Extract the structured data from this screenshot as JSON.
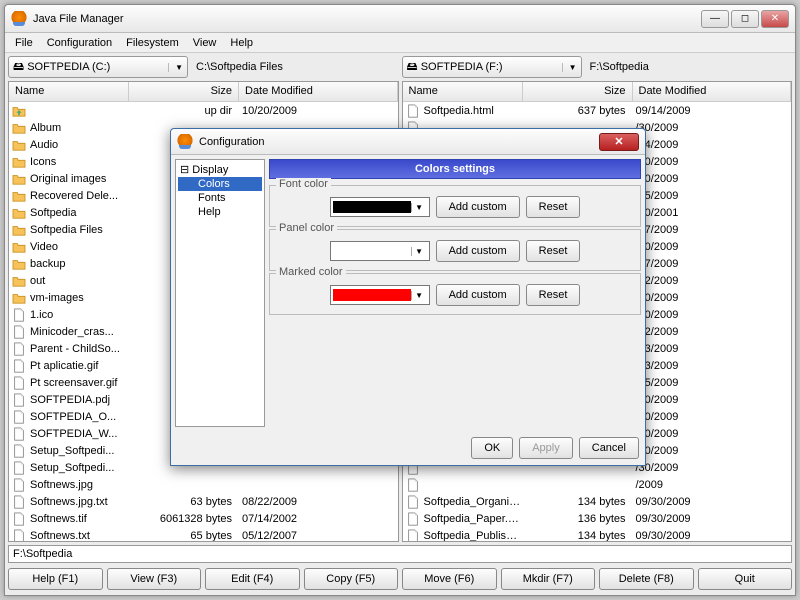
{
  "window": {
    "title": "Java File Manager"
  },
  "menu": [
    "File",
    "Configuration",
    "Filesystem",
    "View",
    "Help"
  ],
  "left": {
    "drive": "SOFTPEDIA (C:)",
    "path": "C:\\Softpedia Files",
    "cols": [
      "Name",
      "Size",
      "Date Modified"
    ],
    "rows": [
      {
        "t": "up",
        "n": "",
        "s": "up dir",
        "d": "10/20/2009"
      },
      {
        "t": "fld",
        "n": "Album",
        "s": "",
        "d": ""
      },
      {
        "t": "fld",
        "n": "Audio",
        "s": "",
        "d": ""
      },
      {
        "t": "fld",
        "n": "Icons",
        "s": "",
        "d": ""
      },
      {
        "t": "fld",
        "n": "Original images",
        "s": "",
        "d": ""
      },
      {
        "t": "fld",
        "n": "Recovered Dele...",
        "s": "",
        "d": ""
      },
      {
        "t": "fld",
        "n": "Softpedia",
        "s": "",
        "d": ""
      },
      {
        "t": "fld",
        "n": "Softpedia Files",
        "s": "",
        "d": ""
      },
      {
        "t": "fld",
        "n": "Video",
        "s": "",
        "d": ""
      },
      {
        "t": "fld",
        "n": "backup",
        "s": "",
        "d": ""
      },
      {
        "t": "fld",
        "n": "out",
        "s": "",
        "d": ""
      },
      {
        "t": "fld",
        "n": "vm-images",
        "s": "",
        "d": ""
      },
      {
        "t": "f",
        "n": "1.ico",
        "s": "",
        "d": ""
      },
      {
        "t": "f",
        "n": "Minicoder_cras...",
        "s": "",
        "d": ""
      },
      {
        "t": "f",
        "n": "Parent - ChildSo...",
        "s": "",
        "d": ""
      },
      {
        "t": "f",
        "n": "Pt aplicatie.gif",
        "s": "",
        "d": ""
      },
      {
        "t": "f",
        "n": "Pt screensaver.gif",
        "s": "",
        "d": ""
      },
      {
        "t": "f",
        "n": "SOFTPEDIA.pdj",
        "s": "",
        "d": ""
      },
      {
        "t": "f",
        "n": "SOFTPEDIA_O...",
        "s": "",
        "d": ""
      },
      {
        "t": "f",
        "n": "SOFTPEDIA_W...",
        "s": "",
        "d": ""
      },
      {
        "t": "f",
        "n": "Setup_Softpedi...",
        "s": "",
        "d": ""
      },
      {
        "t": "f",
        "n": "Setup_Softpedi...",
        "s": "",
        "d": ""
      },
      {
        "t": "f",
        "n": "Softnews.jpg",
        "s": "",
        "d": ""
      },
      {
        "t": "f",
        "n": "Softnews.jpg.txt",
        "s": "63 bytes",
        "d": "08/22/2009"
      },
      {
        "t": "f",
        "n": "Softnews.tif",
        "s": "6061328 bytes",
        "d": "07/14/2002"
      },
      {
        "t": "f",
        "n": "Softnews.txt",
        "s": "65 bytes",
        "d": "05/12/2007"
      }
    ]
  },
  "right": {
    "drive": "SOFTPEDIA (F:)",
    "path": "F:\\Softpedia",
    "cols": [
      "Name",
      "Size",
      "Date Modified"
    ],
    "rows": [
      {
        "t": "f",
        "n": "Softpedia.html",
        "s": "637 bytes",
        "d": "09/14/2009"
      },
      {
        "t": "f",
        "n": "",
        "s": "",
        "d": "/30/2009"
      },
      {
        "t": "f",
        "n": "",
        "s": "",
        "d": "/04/2009"
      },
      {
        "t": "f",
        "n": "",
        "s": "",
        "d": "/30/2009"
      },
      {
        "t": "f",
        "n": "",
        "s": "",
        "d": "/30/2009"
      },
      {
        "t": "f",
        "n": "",
        "s": "",
        "d": "/05/2009"
      },
      {
        "t": "f",
        "n": "",
        "s": "",
        "d": "/30/2001"
      },
      {
        "t": "f",
        "n": "",
        "s": "",
        "d": "/17/2009"
      },
      {
        "t": "f",
        "n": "",
        "s": "",
        "d": "/30/2009"
      },
      {
        "t": "f",
        "n": "",
        "s": "",
        "d": "/17/2009"
      },
      {
        "t": "f",
        "n": "",
        "s": "",
        "d": "/12/2009"
      },
      {
        "t": "f",
        "n": "",
        "s": "",
        "d": "/30/2009"
      },
      {
        "t": "f",
        "n": "",
        "s": "",
        "d": "/30/2009"
      },
      {
        "t": "f",
        "n": "",
        "s": "",
        "d": "/12/2009"
      },
      {
        "t": "f",
        "n": "",
        "s": "",
        "d": "/13/2009"
      },
      {
        "t": "f",
        "n": "",
        "s": "",
        "d": "/13/2009"
      },
      {
        "t": "f",
        "n": "",
        "s": "",
        "d": "/15/2009"
      },
      {
        "t": "f",
        "n": "",
        "s": "",
        "d": "/30/2009"
      },
      {
        "t": "f",
        "n": "",
        "s": "",
        "d": "/30/2009"
      },
      {
        "t": "f",
        "n": "",
        "s": "",
        "d": "/30/2009"
      },
      {
        "t": "f",
        "n": "",
        "s": "",
        "d": "/30/2009"
      },
      {
        "t": "f",
        "n": "",
        "s": "",
        "d": "/30/2009"
      },
      {
        "t": "f",
        "n": "",
        "s": "",
        "d": "/2009"
      },
      {
        "t": "f",
        "n": "Softpedia_Organizati...",
        "s": "134 bytes",
        "d": "09/30/2009"
      },
      {
        "t": "f",
        "n": "Softpedia_Paper.xml",
        "s": "136 bytes",
        "d": "09/30/2009"
      },
      {
        "t": "f",
        "n": "Softpedia_Publisher.x...",
        "s": "134 bytes",
        "d": "09/30/2009"
      }
    ]
  },
  "bottom_path": "F:\\Softpedia",
  "buttons": [
    "Help (F1)",
    "View (F3)",
    "Edit (F4)",
    "Copy (F5)",
    "Move (F6)",
    "Mkdir (F7)",
    "Delete (F8)",
    "Quit"
  ],
  "dialog": {
    "title": "Configuration",
    "tree": {
      "root": "Display",
      "children": [
        "Colors",
        "Fonts",
        "Help"
      ],
      "selected": "Colors"
    },
    "banner": "Colors settings",
    "groups": [
      {
        "label": "Font color",
        "color": "#000000",
        "add": "Add custom",
        "reset": "Reset"
      },
      {
        "label": "Panel color",
        "color": "#ffffff",
        "add": "Add custom",
        "reset": "Reset"
      },
      {
        "label": "Marked color",
        "color": "#ff0000",
        "add": "Add custom",
        "reset": "Reset"
      }
    ],
    "footer": {
      "ok": "OK",
      "apply": "Apply",
      "cancel": "Cancel"
    }
  }
}
